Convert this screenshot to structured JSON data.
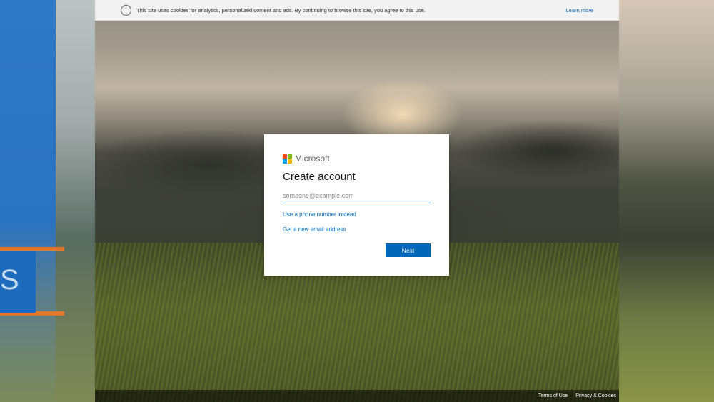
{
  "cookie_banner": {
    "icon": "info-icon",
    "message": "This site uses cookies for analytics, personalized content and ads. By continuing to browse this site, you agree to this use.",
    "learn_more": "Learn more"
  },
  "card": {
    "brand": "Microsoft",
    "logo_colors": [
      "#f25022",
      "#7fba00",
      "#00a4ef",
      "#ffb900"
    ],
    "title": "Create account",
    "email_placeholder": "someone@example.com",
    "email_value": "",
    "phone_link": "Use a phone number instead",
    "new_email_link": "Get a new email address",
    "next_button": "Next",
    "accent_color": "#0067b8"
  },
  "footer": {
    "terms": "Terms of Use",
    "privacy": "Privacy & Cookies"
  }
}
